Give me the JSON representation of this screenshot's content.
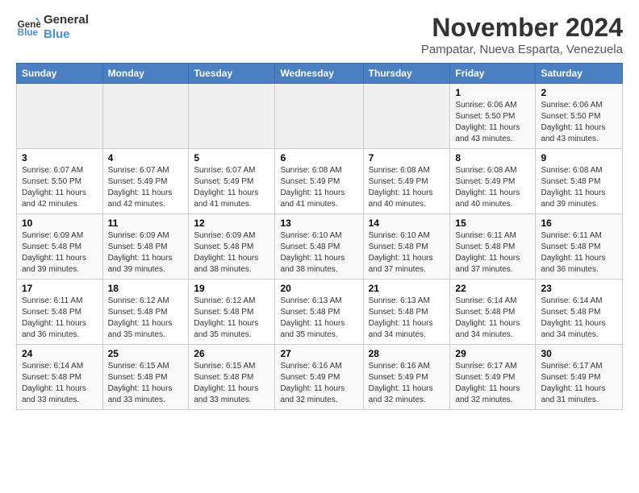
{
  "logo": {
    "line1": "General",
    "line2": "Blue"
  },
  "title": "November 2024",
  "subtitle": "Pampatar, Nueva Esparta, Venezuela",
  "days_of_week": [
    "Sunday",
    "Monday",
    "Tuesday",
    "Wednesday",
    "Thursday",
    "Friday",
    "Saturday"
  ],
  "weeks": [
    [
      {
        "day": "",
        "info": ""
      },
      {
        "day": "",
        "info": ""
      },
      {
        "day": "",
        "info": ""
      },
      {
        "day": "",
        "info": ""
      },
      {
        "day": "",
        "info": ""
      },
      {
        "day": "1",
        "info": "Sunrise: 6:06 AM\nSunset: 5:50 PM\nDaylight: 11 hours and 43 minutes."
      },
      {
        "day": "2",
        "info": "Sunrise: 6:06 AM\nSunset: 5:50 PM\nDaylight: 11 hours and 43 minutes."
      }
    ],
    [
      {
        "day": "3",
        "info": "Sunrise: 6:07 AM\nSunset: 5:50 PM\nDaylight: 11 hours and 42 minutes."
      },
      {
        "day": "4",
        "info": "Sunrise: 6:07 AM\nSunset: 5:49 PM\nDaylight: 11 hours and 42 minutes."
      },
      {
        "day": "5",
        "info": "Sunrise: 6:07 AM\nSunset: 5:49 PM\nDaylight: 11 hours and 41 minutes."
      },
      {
        "day": "6",
        "info": "Sunrise: 6:08 AM\nSunset: 5:49 PM\nDaylight: 11 hours and 41 minutes."
      },
      {
        "day": "7",
        "info": "Sunrise: 6:08 AM\nSunset: 5:49 PM\nDaylight: 11 hours and 40 minutes."
      },
      {
        "day": "8",
        "info": "Sunrise: 6:08 AM\nSunset: 5:49 PM\nDaylight: 11 hours and 40 minutes."
      },
      {
        "day": "9",
        "info": "Sunrise: 6:08 AM\nSunset: 5:48 PM\nDaylight: 11 hours and 39 minutes."
      }
    ],
    [
      {
        "day": "10",
        "info": "Sunrise: 6:09 AM\nSunset: 5:48 PM\nDaylight: 11 hours and 39 minutes."
      },
      {
        "day": "11",
        "info": "Sunrise: 6:09 AM\nSunset: 5:48 PM\nDaylight: 11 hours and 39 minutes."
      },
      {
        "day": "12",
        "info": "Sunrise: 6:09 AM\nSunset: 5:48 PM\nDaylight: 11 hours and 38 minutes."
      },
      {
        "day": "13",
        "info": "Sunrise: 6:10 AM\nSunset: 5:48 PM\nDaylight: 11 hours and 38 minutes."
      },
      {
        "day": "14",
        "info": "Sunrise: 6:10 AM\nSunset: 5:48 PM\nDaylight: 11 hours and 37 minutes."
      },
      {
        "day": "15",
        "info": "Sunrise: 6:11 AM\nSunset: 5:48 PM\nDaylight: 11 hours and 37 minutes."
      },
      {
        "day": "16",
        "info": "Sunrise: 6:11 AM\nSunset: 5:48 PM\nDaylight: 11 hours and 36 minutes."
      }
    ],
    [
      {
        "day": "17",
        "info": "Sunrise: 6:11 AM\nSunset: 5:48 PM\nDaylight: 11 hours and 36 minutes."
      },
      {
        "day": "18",
        "info": "Sunrise: 6:12 AM\nSunset: 5:48 PM\nDaylight: 11 hours and 35 minutes."
      },
      {
        "day": "19",
        "info": "Sunrise: 6:12 AM\nSunset: 5:48 PM\nDaylight: 11 hours and 35 minutes."
      },
      {
        "day": "20",
        "info": "Sunrise: 6:13 AM\nSunset: 5:48 PM\nDaylight: 11 hours and 35 minutes."
      },
      {
        "day": "21",
        "info": "Sunrise: 6:13 AM\nSunset: 5:48 PM\nDaylight: 11 hours and 34 minutes."
      },
      {
        "day": "22",
        "info": "Sunrise: 6:14 AM\nSunset: 5:48 PM\nDaylight: 11 hours and 34 minutes."
      },
      {
        "day": "23",
        "info": "Sunrise: 6:14 AM\nSunset: 5:48 PM\nDaylight: 11 hours and 34 minutes."
      }
    ],
    [
      {
        "day": "24",
        "info": "Sunrise: 6:14 AM\nSunset: 5:48 PM\nDaylight: 11 hours and 33 minutes."
      },
      {
        "day": "25",
        "info": "Sunrise: 6:15 AM\nSunset: 5:48 PM\nDaylight: 11 hours and 33 minutes."
      },
      {
        "day": "26",
        "info": "Sunrise: 6:15 AM\nSunset: 5:48 PM\nDaylight: 11 hours and 33 minutes."
      },
      {
        "day": "27",
        "info": "Sunrise: 6:16 AM\nSunset: 5:49 PM\nDaylight: 11 hours and 32 minutes."
      },
      {
        "day": "28",
        "info": "Sunrise: 6:16 AM\nSunset: 5:49 PM\nDaylight: 11 hours and 32 minutes."
      },
      {
        "day": "29",
        "info": "Sunrise: 6:17 AM\nSunset: 5:49 PM\nDaylight: 11 hours and 32 minutes."
      },
      {
        "day": "30",
        "info": "Sunrise: 6:17 AM\nSunset: 5:49 PM\nDaylight: 11 hours and 31 minutes."
      }
    ]
  ]
}
